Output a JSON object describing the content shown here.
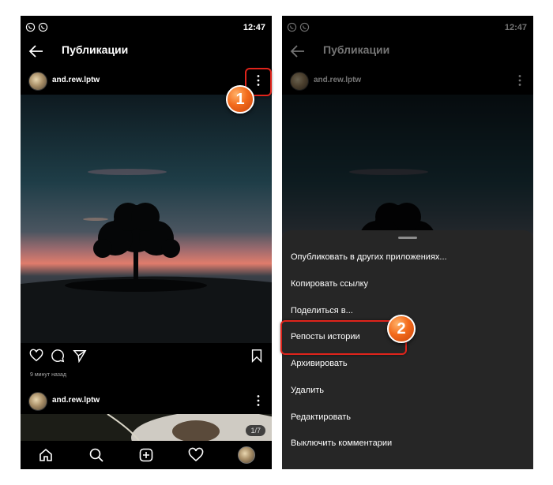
{
  "status_bar": {
    "time": "12:47"
  },
  "header": {
    "title": "Публикации"
  },
  "post": {
    "username": "and.rew.lptw",
    "time_ago": "9 минут назад"
  },
  "second_post": {
    "username": "and.rew.lptw",
    "pager": "1/7"
  },
  "menu": {
    "items": [
      "Опубликовать в других приложениях...",
      "Копировать ссылку",
      "Поделиться в...",
      "Репосты истории",
      "Архивировать",
      "Удалить",
      "Редактировать",
      "Выключить комментарии"
    ]
  },
  "callouts": {
    "step1": "1",
    "step2": "2",
    "color": "#e0241b"
  }
}
